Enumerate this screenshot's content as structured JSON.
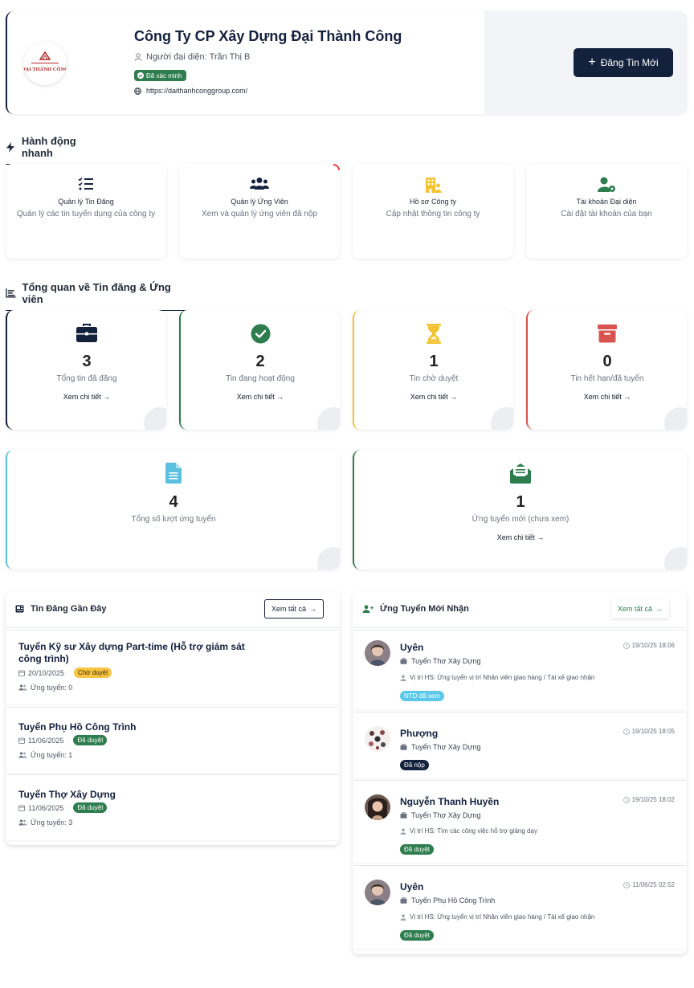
{
  "company": {
    "name": "Công Ty CP Xây Dựng Đại Thành Công",
    "representative": "Người đại diện: Trần Thị B",
    "verified_label": "Đã xác minh",
    "website": "https://daithanhconggroup.com/",
    "logo_text": "ĐẠI THÀNH CÔNG",
    "new_post_button": "Đăng Tin Mới"
  },
  "quick_actions": {
    "title": "Hành động nhanh",
    "items": [
      {
        "title": "Quản lý Tin Đăng",
        "desc": "Quản lý các tin tuyển dụng của công ty",
        "icon": "list-check-icon"
      },
      {
        "title": "Quản lý Ứng Viên",
        "desc": "Xem và quản lý ứng viên đã nộp",
        "icon": "users-icon"
      },
      {
        "title": "Hồ sơ Công ty",
        "desc": "Cập nhật thông tin công ty",
        "icon": "building-icon"
      },
      {
        "title": "Tài khoản Đại diện",
        "desc": "Cài đặt tài khoản của bạn",
        "icon": "user-gear-icon"
      }
    ]
  },
  "overview": {
    "title": "Tổng quan về Tin đăng & Ứng viên",
    "stats": [
      {
        "value": "3",
        "label": "Tổng tin đã đăng",
        "link": "Xem chi tiết →",
        "color": "#14213d"
      },
      {
        "value": "2",
        "label": "Tin đang hoạt động",
        "link": "Xem chi tiết →",
        "color": "#2e7d4f"
      },
      {
        "value": "1",
        "label": "Tin chờ duyệt",
        "link": "Xem chi tiết →",
        "color": "#f2c230"
      },
      {
        "value": "0",
        "label": "Tin hết hạn/đã tuyển",
        "link": "Xem chi tiết →",
        "color": "#d9534f"
      },
      {
        "value": "4",
        "label": "Tổng số lượt ứng tuyển",
        "color": "#5bc0de"
      },
      {
        "value": "1",
        "label": "Ứng tuyển mới (chưa xem)",
        "link": "Xem chi tiết →",
        "color": "#2e7d4f"
      }
    ]
  },
  "recent_jobs": {
    "title": "Tin Đăng Gần Đây",
    "view_all": "Xem tất cả",
    "items": [
      {
        "title": "Tuyển Kỹ sư Xây dựng Part-time (Hỗ trợ giám sát công trình)",
        "date": "20/10/2025",
        "status": "Chờ duyệt",
        "applicants": "Ứng tuyển: 0"
      },
      {
        "title": "Tuyển Phụ Hồ Công Trình",
        "date": "11/06/2025",
        "status": "Đã duyệt",
        "applicants": "Ứng tuyển: 1"
      },
      {
        "title": "Tuyển Thợ Xây Dựng",
        "date": "11/06/2025",
        "status": "Đã duyệt",
        "applicants": "Ứng tuyển: 3"
      }
    ]
  },
  "new_applications": {
    "title": "Ứng Tuyển Mới Nhận",
    "view_all": "Xem tất cả",
    "items": [
      {
        "name": "Uyên",
        "time": "19/10/25 18:06",
        "job": "Tuyển Thợ Xây Dựng",
        "position": "Vị trí HS: Ứng tuyển vị trí Nhân viên giao hàng / Tài xế giao nhận",
        "status": "NTD đã xem"
      },
      {
        "name": "Phượng",
        "time": "19/10/25 18:05",
        "job": "Tuyển Thợ Xây Dựng",
        "position": "",
        "status": "Đã nộp"
      },
      {
        "name": "Nguyễn Thanh Huyền",
        "time": "19/10/25 18:02",
        "job": "Tuyển Thợ Xây Dựng",
        "position": "Vị trí HS: Tìm các công việc hỗ trợ giảng dạy",
        "status": "Đã duyệt"
      },
      {
        "name": "Uyên",
        "time": "11/06/25 02:52",
        "job": "Tuyển Phụ Hồ Công Trình",
        "position": "Vị trí HS: Ứng tuyển vị trí Nhân viên giao hàng / Tài xế giao nhận",
        "status": "Đã duyệt"
      }
    ]
  }
}
